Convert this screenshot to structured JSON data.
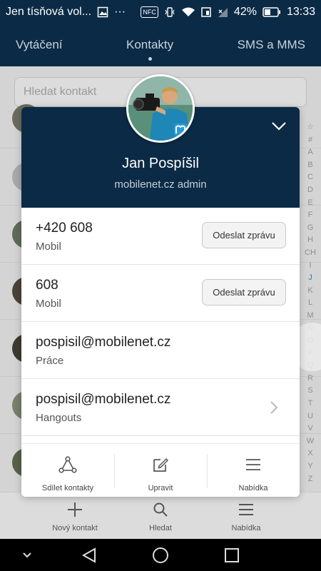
{
  "status_bar": {
    "notification": "Jen tísňová vol...",
    "more": "···",
    "nfc": "NFC",
    "battery": "42%",
    "time": "13:33"
  },
  "tabs": [
    {
      "label": "Vytáčení"
    },
    {
      "label": "Kontakty"
    },
    {
      "label": "SMS a MMS"
    }
  ],
  "search": {
    "placeholder": "Hledat kontakt"
  },
  "alphabet": [
    "☆",
    "#",
    "A",
    "B",
    "C",
    "D",
    "E",
    "F",
    "G",
    "H",
    "CH",
    "I",
    "J",
    "K",
    "L",
    "M",
    "N",
    "O",
    "P",
    "Q",
    "R",
    "S",
    "T",
    "U",
    "V",
    "W",
    "X",
    "Y",
    "Z"
  ],
  "active_letter": "J",
  "contact": {
    "name": "Jan Pospíšil",
    "subtitle": "mobilenet.cz admin",
    "rows": [
      {
        "main": "+420 608",
        "sub": "Mobil",
        "button": "Odeslat zprávu"
      },
      {
        "main": "608",
        "sub": "Mobil",
        "button": "Odeslat zprávu"
      },
      {
        "main": "pospisil@mobilenet.cz",
        "sub": "Práce"
      },
      {
        "main": "pospisil@mobilenet.cz",
        "sub": "Hangouts"
      }
    ],
    "actions": [
      {
        "label": "Sdílet kontakty",
        "icon": "share-icon"
      },
      {
        "label": "Upravit",
        "icon": "edit-icon"
      },
      {
        "label": "Nabídka",
        "icon": "menu-icon"
      }
    ]
  },
  "bottom_bar": [
    {
      "label": "Nový kontakt",
      "icon": "plus-icon"
    },
    {
      "label": "Hledat",
      "icon": "search-icon"
    },
    {
      "label": "Nabídka",
      "icon": "menu-icon"
    }
  ],
  "colors": {
    "header": "#0b2a45",
    "accent": "#2a7fb8"
  }
}
